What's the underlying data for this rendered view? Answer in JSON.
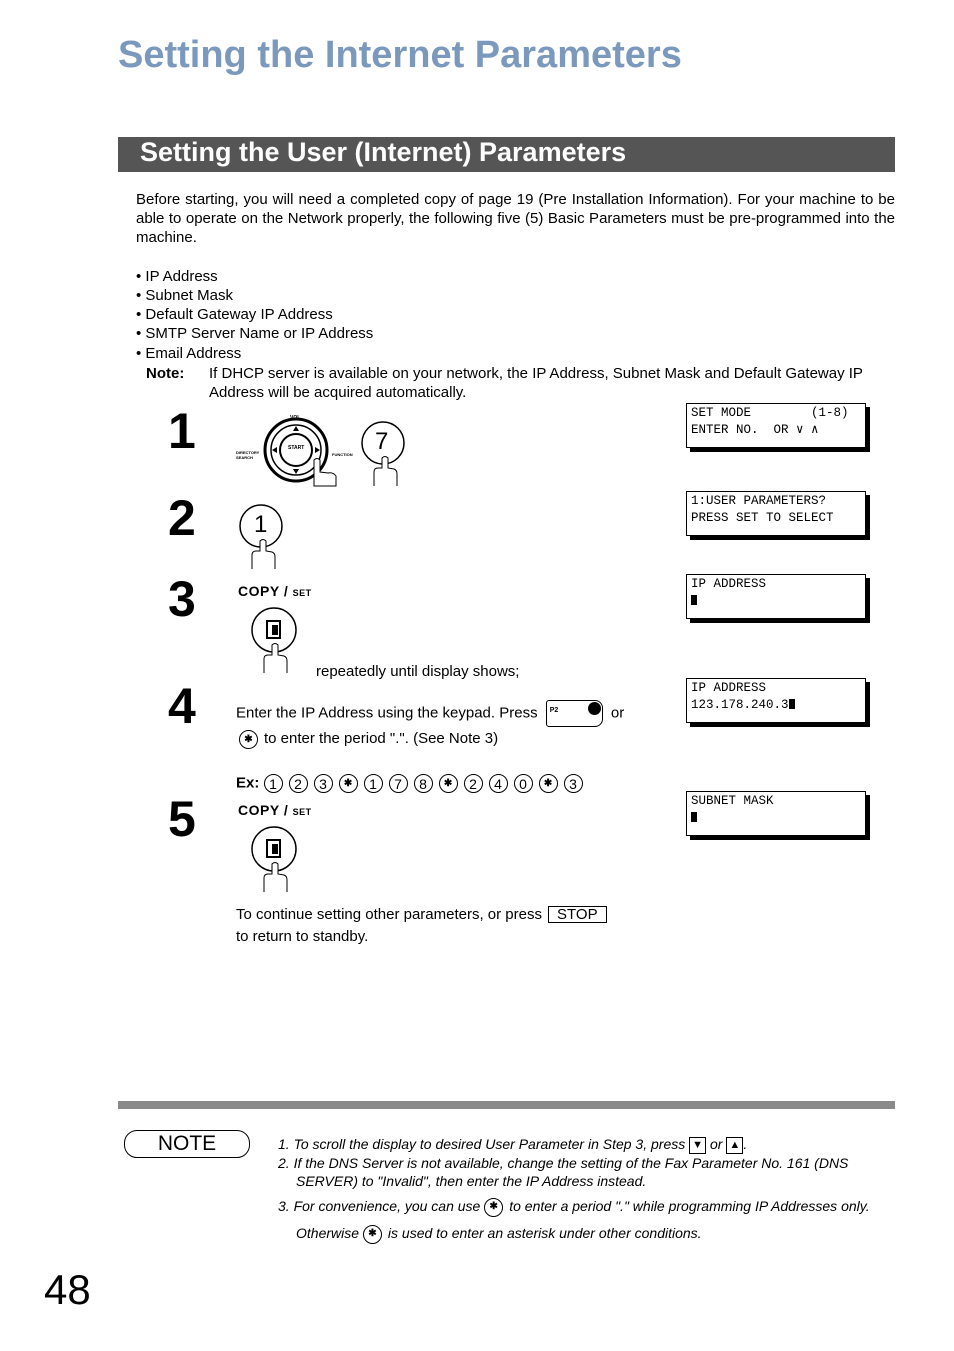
{
  "title": "Setting the Internet Parameters",
  "section_title": "Setting the User (Internet) Parameters",
  "intro": "Before starting, you will need a completed copy of page 19 (Pre Installation Information).  For your machine to be able to operate on the Network properly, the following five (5) Basic Parameters must be pre-programmed into the machine.",
  "bullets": [
    "• IP Address",
    "• Subnet Mask",
    "• Default Gateway IP Address",
    "• SMTP Server Name or IP Address",
    "• Email Address"
  ],
  "note_label": "Note:",
  "note_text": "If DHCP server is available on your network, the IP Address, Subnet Mask and Default Gateway IP Address will be acquired automatically.",
  "steps": [
    {
      "num": "1",
      "key": "7",
      "dial": {
        "top": "VOL.",
        "left": "DIRECTORY SEARCH",
        "right": "FUNCTION",
        "center": "START"
      },
      "lcd": [
        "SET MODE        (1-8)",
        "ENTER NO.  OR ∨ ∧"
      ]
    },
    {
      "num": "2",
      "key": "1",
      "lcd": [
        "1:USER PARAMETERS?",
        "PRESS SET TO SELECT"
      ]
    },
    {
      "num": "3",
      "copy": "COPY",
      "set": "SET",
      "text": "repeatedly until display shows;",
      "lcd": [
        "IP ADDRESS",
        ""
      ]
    },
    {
      "num": "4",
      "text_a": "Enter the IP Address using the keypad. Press",
      "p2": "P2",
      "or": "or",
      "text_b": "to enter the period \".\".  (See Note 3)",
      "ex_label": "Ex:",
      "ex_keys": [
        "1",
        "2",
        "3",
        "✱",
        "1",
        "7",
        "8",
        "✱",
        "2",
        "4",
        "0",
        "✱",
        "3"
      ],
      "lcd": [
        "IP ADDRESS",
        "123.178.240.3"
      ]
    },
    {
      "num": "5",
      "copy": "COPY",
      "set": "SET",
      "text_a": "To continue setting other parameters, or press",
      "stop": "STOP",
      "text_b": "to return to standby.",
      "lcd": [
        "SUBNET MASK",
        ""
      ]
    }
  ],
  "notes": {
    "label": "NOTE",
    "n1a": "1.  To scroll the display to desired User Parameter in Step 3, press",
    "n1or": "or",
    "n2a": "2.  If the DNS Server is not available, change the setting of the Fax Parameter No. 161 (DNS",
    "n2b": "SERVER) to \"Invalid\", then enter the IP Address instead.",
    "n3a": "3.  For convenience, you can use",
    "n3b": "to enter a period \".\" while programming IP Addresses only.",
    "n3c": "Otherwise",
    "n3d": "is used to enter an asterisk under other conditions."
  },
  "page_number": "48"
}
